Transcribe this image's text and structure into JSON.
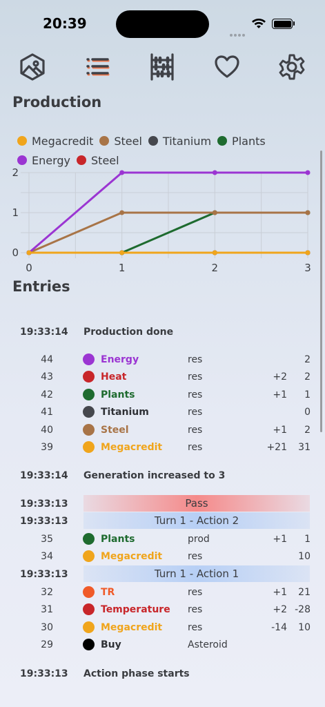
{
  "status": {
    "time": "20:39"
  },
  "toolbar": {
    "items": [
      {
        "icon": "map-hexagon-icon"
      },
      {
        "icon": "list-icon",
        "active": true
      },
      {
        "icon": "abacus-icon"
      },
      {
        "icon": "heart-icon"
      },
      {
        "icon": "gear-icon"
      }
    ]
  },
  "production": {
    "title": "Production",
    "legend": [
      {
        "label": "Megacredit",
        "color": "#f0a51c"
      },
      {
        "label": "Steel",
        "color": "#a87447"
      },
      {
        "label": "Titanium",
        "color": "#45474d"
      },
      {
        "label": "Plants",
        "color": "#1e6b2f"
      },
      {
        "label": "Energy",
        "color": "#9b35d2"
      },
      {
        "label": "Steel",
        "color": "#c8262a"
      }
    ]
  },
  "chart_data": {
    "type": "line",
    "x": [
      0,
      1,
      2,
      3
    ],
    "xlim": [
      0,
      3
    ],
    "ylim": [
      0,
      2
    ],
    "x_ticks": [
      "0",
      "1",
      "2",
      "3"
    ],
    "y_ticks": [
      "0",
      "1",
      "2"
    ],
    "grid": true,
    "legend_position": "top",
    "series": [
      {
        "name": "Megacredit",
        "color": "#f0a51c",
        "values": [
          0,
          0,
          0,
          0
        ]
      },
      {
        "name": "Steel",
        "color": "#a87447",
        "values": [
          0,
          1,
          1,
          1
        ]
      },
      {
        "name": "Titanium",
        "color": "#45474d",
        "values": [
          0,
          0,
          0,
          0
        ]
      },
      {
        "name": "Plants",
        "color": "#1e6b2f",
        "values": [
          0,
          0,
          1,
          1
        ]
      },
      {
        "name": "Energy",
        "color": "#9b35d2",
        "values": [
          0,
          2,
          2,
          2
        ]
      },
      {
        "name": "Steel",
        "color": "#c8262a",
        "values": [
          0,
          0,
          0,
          0
        ]
      }
    ]
  },
  "entries": {
    "title": "Entries",
    "rows": [
      {
        "kind": "event",
        "time": "19:33:14",
        "text": "Production done"
      },
      {
        "kind": "res",
        "idx": "44",
        "name": "Energy",
        "color": "#9b35d2",
        "type": "res",
        "delta": "",
        "value": "2"
      },
      {
        "kind": "res",
        "idx": "43",
        "name": "Heat",
        "color": "#c8262a",
        "type": "res",
        "delta": "+2",
        "value": "2"
      },
      {
        "kind": "res",
        "idx": "42",
        "name": "Plants",
        "color": "#1e6b2f",
        "type": "res",
        "delta": "+1",
        "value": "1"
      },
      {
        "kind": "res",
        "idx": "41",
        "name": "Titanium",
        "color": "#45474d",
        "type": "res",
        "delta": "",
        "value": "0"
      },
      {
        "kind": "res",
        "idx": "40",
        "name": "Steel",
        "color": "#a87447",
        "type": "res",
        "delta": "+1",
        "value": "2"
      },
      {
        "kind": "res",
        "idx": "39",
        "name": "Megacredit",
        "color": "#f0a51c",
        "type": "res",
        "delta": "+21",
        "value": "31"
      },
      {
        "kind": "event",
        "time": "19:33:14",
        "text": "Generation increased to 3"
      },
      {
        "kind": "banner",
        "style": "pass",
        "time": "19:33:13",
        "text": "Pass"
      },
      {
        "kind": "banner",
        "style": "turn",
        "time": "19:33:13",
        "text": "Turn 1 - Action 2"
      },
      {
        "kind": "res",
        "idx": "35",
        "name": "Plants",
        "color": "#1e6b2f",
        "type": "prod",
        "delta": "+1",
        "value": "1"
      },
      {
        "kind": "res",
        "idx": "34",
        "name": "Megacredit",
        "color": "#f0a51c",
        "type": "res",
        "delta": "",
        "value": "10"
      },
      {
        "kind": "banner",
        "style": "turn",
        "time": "19:33:13",
        "text": "Turn 1 - Action 1"
      },
      {
        "kind": "res",
        "idx": "32",
        "name": "TR",
        "color": "#f05a28",
        "type": "res",
        "delta": "+1",
        "value": "21"
      },
      {
        "kind": "res",
        "idx": "31",
        "name": "Temperature",
        "color": "#c8262a",
        "type": "res",
        "delta": "+2",
        "value": "-28"
      },
      {
        "kind": "res",
        "idx": "30",
        "name": "Megacredit",
        "color": "#f0a51c",
        "type": "res",
        "delta": "-14",
        "value": "10"
      },
      {
        "kind": "res",
        "idx": "29",
        "name": "Buy",
        "color": "#000000",
        "type": "Asteroid",
        "delta": "",
        "value": ""
      },
      {
        "kind": "event",
        "time": "19:33:13",
        "text": "Action phase starts"
      }
    ]
  }
}
